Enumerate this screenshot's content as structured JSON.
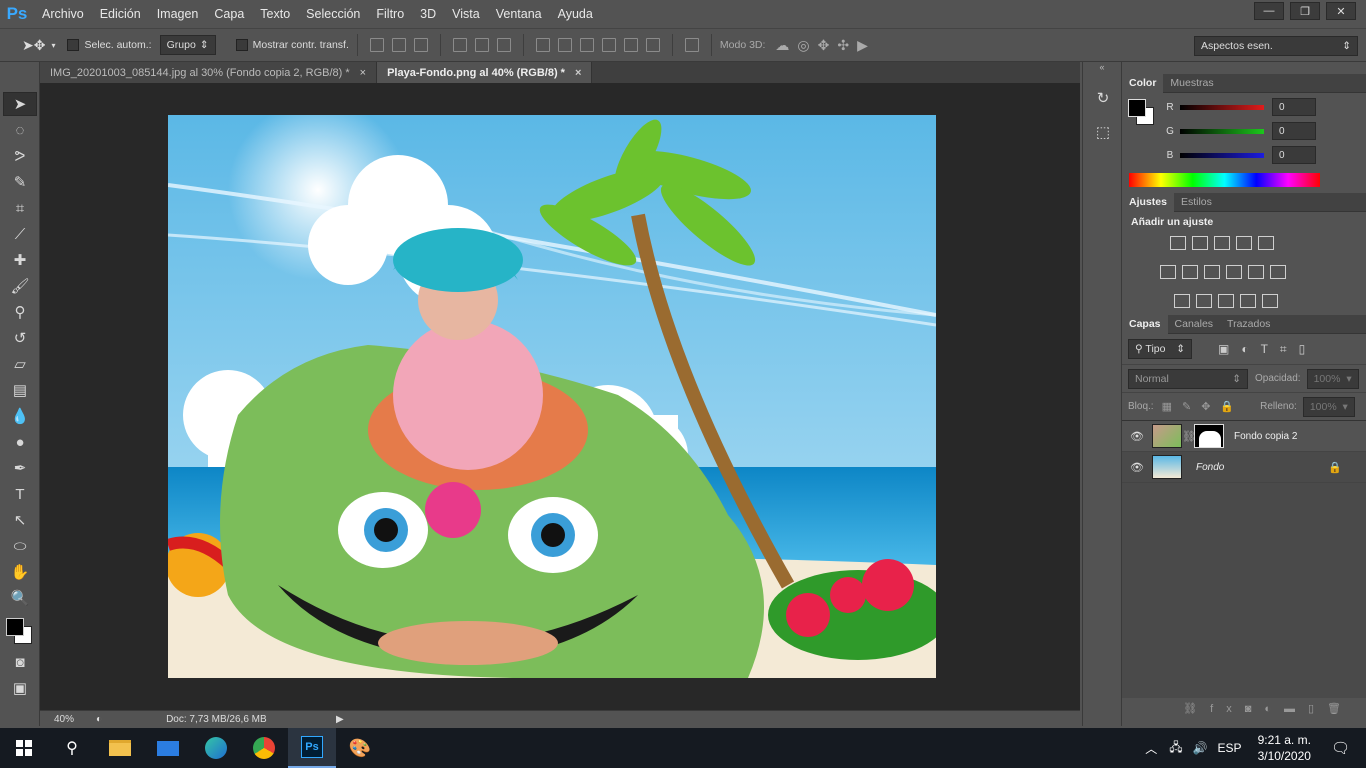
{
  "app": {
    "logo": "Ps"
  },
  "menu": [
    "Archivo",
    "Edición",
    "Imagen",
    "Capa",
    "Texto",
    "Selección",
    "Filtro",
    "3D",
    "Vista",
    "Ventana",
    "Ayuda"
  ],
  "window_buttons": {
    "minimize": "—",
    "restore": "❐",
    "close": "✕"
  },
  "options": {
    "auto_select_label": "Selec. autom.:",
    "auto_select_value": "Grupo",
    "show_transform_label": "Mostrar contr. transf.",
    "mode3d_label": "Modo 3D:",
    "workspace": "Aspectos esen."
  },
  "tabs": [
    {
      "label": "IMG_20201003_085144.jpg al 30% (Fondo copia 2, RGB/8) *",
      "close": "×"
    },
    {
      "label": "Playa-Fondo.png al 40% (RGB/8) *",
      "close": "×"
    }
  ],
  "status": {
    "zoom": "40%",
    "doc": "Doc: 7,73 MB/26,6 MB"
  },
  "color_panel": {
    "tabs": [
      "Color",
      "Muestras"
    ],
    "channels": [
      {
        "name": "R",
        "value": "0",
        "color": "#d81818"
      },
      {
        "name": "G",
        "value": "0",
        "color": "#18b418"
      },
      {
        "name": "B",
        "value": "0",
        "color": "#1818d8"
      }
    ]
  },
  "adjust_panel": {
    "tabs": [
      "Ajustes",
      "Estilos"
    ],
    "heading": "Añadir un ajuste"
  },
  "layers_panel": {
    "tabs": [
      "Capas",
      "Canales",
      "Trazados"
    ],
    "filter": "Tipo",
    "blend_mode": "Normal",
    "opacity_label": "Opacidad:",
    "opacity_value": "100%",
    "lock_label": "Bloq.:",
    "fill_label": "Relleno:",
    "fill_value": "100%",
    "layers": [
      {
        "name": "Fondo copia 2",
        "visible": true
      },
      {
        "name": "Fondo",
        "visible": true,
        "locked": true
      }
    ]
  },
  "taskbar": {
    "lang": "ESP",
    "time": "9:21 a. m.",
    "date": "3/10/2020"
  }
}
